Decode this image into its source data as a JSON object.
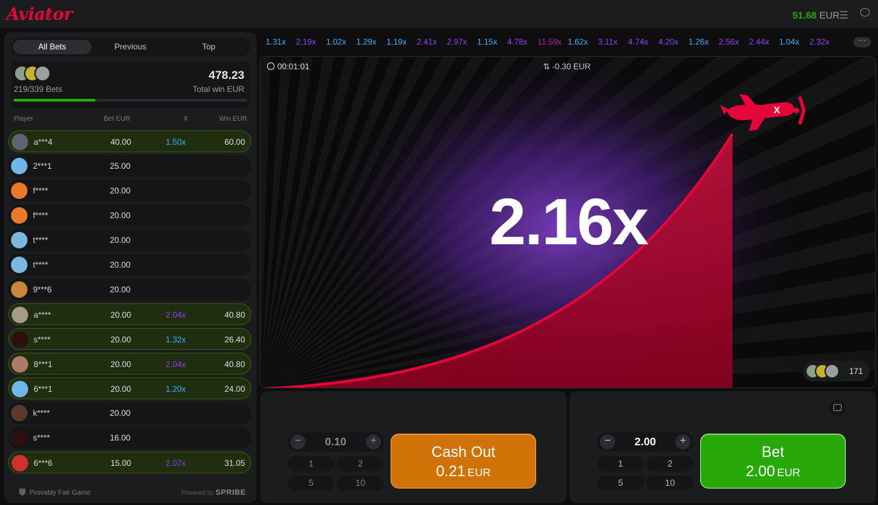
{
  "header": {
    "logo": "Aviator",
    "balance": "51.68",
    "currency": "EUR",
    "menu_icon": "menu-icon",
    "chat_icon": "chat-icon"
  },
  "left": {
    "tabs": [
      "All Bets",
      "Previous",
      "Top"
    ],
    "active_tab": 0,
    "summary": {
      "bets": "219/339",
      "bets_label": "Bets",
      "total_win": "478.23",
      "total_win_label": "Total win EUR",
      "progress": 0.35
    },
    "columns": {
      "player": "Player",
      "bet": "Bet EUR",
      "x": "X",
      "win": "Win EUR"
    },
    "rows": [
      {
        "player": "a***4",
        "bet": "40.00",
        "mult": "1.50x",
        "win": "60.00",
        "won": true,
        "mult_color": "#34b4ff",
        "avatar": "#5c6470"
      },
      {
        "player": "2***1",
        "bet": "25.00",
        "mult": "",
        "win": "",
        "won": false,
        "mult_color": "",
        "avatar": "#6fb7e8"
      },
      {
        "player": "f****",
        "bet": "20.00",
        "mult": "",
        "win": "",
        "won": false,
        "mult_color": "",
        "avatar": "#e8782a"
      },
      {
        "player": "f****",
        "bet": "20.00",
        "mult": "",
        "win": "",
        "won": false,
        "mult_color": "",
        "avatar": "#e8782a"
      },
      {
        "player": "t****",
        "bet": "20.00",
        "mult": "",
        "win": "",
        "won": false,
        "mult_color": "",
        "avatar": "#7ab8e0"
      },
      {
        "player": "t****",
        "bet": "20.00",
        "mult": "",
        "win": "",
        "won": false,
        "mult_color": "",
        "avatar": "#7ab8e0"
      },
      {
        "player": "9***6",
        "bet": "20.00",
        "mult": "",
        "win": "",
        "won": false,
        "mult_color": "",
        "avatar": "#c9873a"
      },
      {
        "player": "a****",
        "bet": "20.00",
        "mult": "2.04x",
        "win": "40.80",
        "won": true,
        "mult_color": "#913ef8",
        "avatar": "#a89a88"
      },
      {
        "player": "s****",
        "bet": "20.00",
        "mult": "1.32x",
        "win": "26.40",
        "won": true,
        "mult_color": "#34b4ff",
        "avatar": "#2a1010"
      },
      {
        "player": "8***1",
        "bet": "20.00",
        "mult": "2.04x",
        "win": "40.80",
        "won": true,
        "mult_color": "#913ef8",
        "avatar": "#b07a6a"
      },
      {
        "player": "6***1",
        "bet": "20.00",
        "mult": "1.20x",
        "win": "24.00",
        "won": true,
        "mult_color": "#34b4ff",
        "avatar": "#6fb7e8"
      },
      {
        "player": "k****",
        "bet": "20.00",
        "mult": "",
        "win": "",
        "won": false,
        "mult_color": "",
        "avatar": "#5a3a2a"
      },
      {
        "player": "s****",
        "bet": "16.00",
        "mult": "",
        "win": "",
        "won": false,
        "mult_color": "",
        "avatar": "#2a1010"
      },
      {
        "player": "6***6",
        "bet": "15.00",
        "mult": "2.07x",
        "win": "31.05",
        "won": true,
        "mult_color": "#913ef8",
        "avatar": "#d03030"
      }
    ],
    "footer": "Provably Fair Game",
    "powered": "Powered by",
    "powered_brand": "SPRIBE"
  },
  "history": [
    {
      "v": "1.31x",
      "c": "#34b4ff"
    },
    {
      "v": "2.19x",
      "c": "#913ef8"
    },
    {
      "v": "1.02x",
      "c": "#34b4ff"
    },
    {
      "v": "1.29x",
      "c": "#34b4ff"
    },
    {
      "v": "1.19x",
      "c": "#34b4ff"
    },
    {
      "v": "2.41x",
      "c": "#913ef8"
    },
    {
      "v": "2.97x",
      "c": "#913ef8"
    },
    {
      "v": "1.15x",
      "c": "#34b4ff"
    },
    {
      "v": "4.78x",
      "c": "#913ef8"
    },
    {
      "v": "11.59x",
      "c": "#c017b4"
    },
    {
      "v": "1.62x",
      "c": "#34b4ff"
    },
    {
      "v": "3.11x",
      "c": "#913ef8"
    },
    {
      "v": "4.74x",
      "c": "#913ef8"
    },
    {
      "v": "4.20x",
      "c": "#913ef8"
    },
    {
      "v": "1.26x",
      "c": "#34b4ff"
    },
    {
      "v": "2.56x",
      "c": "#913ef8"
    },
    {
      "v": "2.44x",
      "c": "#913ef8"
    },
    {
      "v": "1.04x",
      "c": "#34b4ff"
    },
    {
      "v": "2.32x",
      "c": "#913ef8"
    }
  ],
  "history_more": "···",
  "game": {
    "timer": "00:01:01",
    "delta": "-0.30 EUR",
    "multiplier": "2.16x",
    "players_online": "171"
  },
  "panel1": {
    "stepper_value": "0.10",
    "quick": [
      "1",
      "2",
      "5",
      "10"
    ],
    "button_line1": "Cash Out",
    "button_amount": "0.21",
    "button_currency": "EUR"
  },
  "panel2": {
    "stepper_value": "2.00",
    "quick": [
      "1",
      "2",
      "5",
      "10"
    ],
    "button_line1": "Bet",
    "button_amount": "2.00",
    "button_currency": "EUR"
  }
}
